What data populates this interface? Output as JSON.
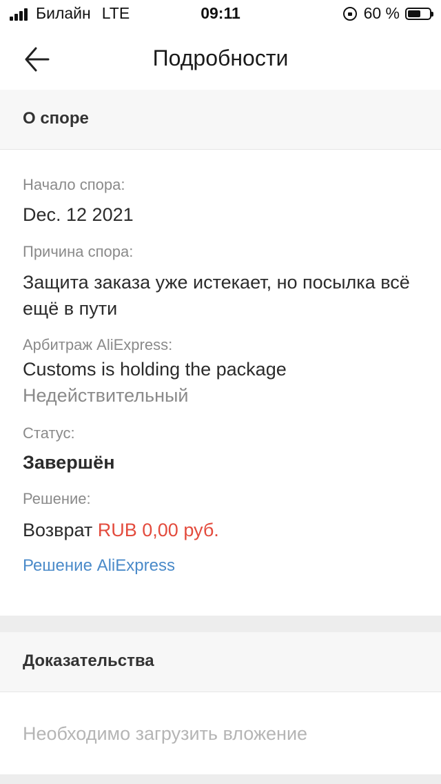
{
  "status_bar": {
    "carrier": "Билайн",
    "network": "LTE",
    "time": "09:11",
    "battery_percent": "60 %",
    "battery_level": 0.6
  },
  "nav": {
    "title": "Подробности"
  },
  "dispute": {
    "section_title": "О споре",
    "start_label": "Начало спора:",
    "start_value": "Dec. 12 2021",
    "reason_label": "Причина спора:",
    "reason_value": "Защита заказа уже истекает, но посылка всё ещё в пути",
    "arbitration_label": "Арбитраж AliExpress:",
    "arbitration_value": "Customs is holding the package",
    "arbitration_validity": "Недействительный",
    "status_label": "Статус:",
    "status_value": "Завершён",
    "resolution_label": "Решение:",
    "resolution_prefix": "Возврат",
    "resolution_amount": "RUB 0,00 руб.",
    "resolution_link": "Решение AliExpress"
  },
  "evidence": {
    "section_title": "Доказательства",
    "placeholder": "Необходимо загрузить вложение"
  },
  "colors": {
    "accent_link": "#4a8ac9",
    "amount_red": "#e34b3d"
  }
}
